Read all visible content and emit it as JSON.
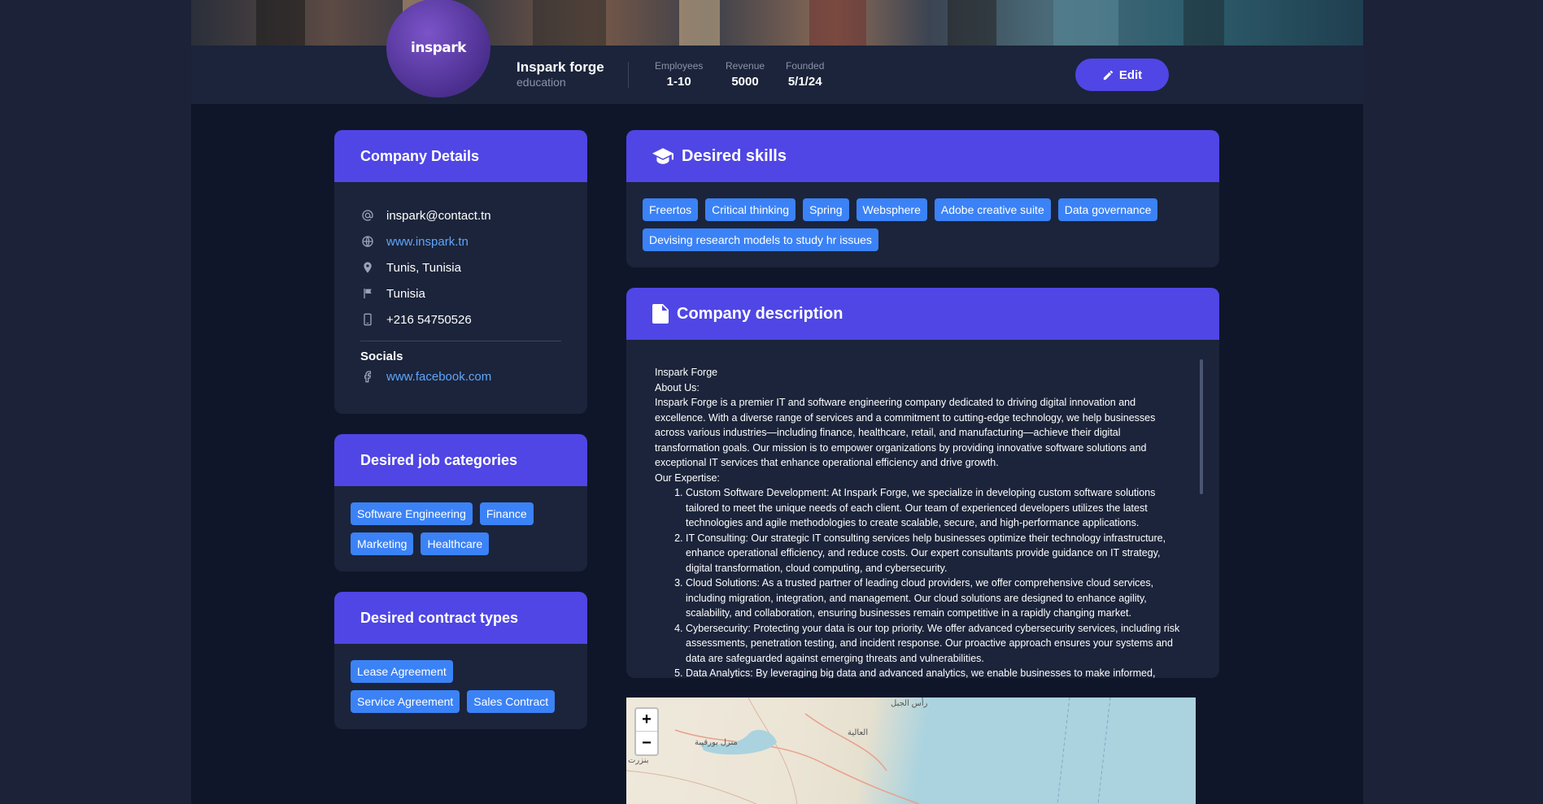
{
  "header": {
    "logo_text": "inspark",
    "company_name": "Inspark forge",
    "sector": "education",
    "stats": [
      {
        "label": "Employees",
        "value": "1-10"
      },
      {
        "label": "Revenue",
        "value": "5000"
      },
      {
        "label": "Founded",
        "value": "5/1/24"
      }
    ],
    "edit_label": "Edit"
  },
  "company_details": {
    "title": "Company Details",
    "email": "inspark@contact.tn",
    "website": "www.inspark.tn",
    "location": "Tunis, Tunisia",
    "country": "Tunisia",
    "phone": "+216 54750526",
    "socials_label": "Socials",
    "facebook": "www.facebook.com"
  },
  "job_categories": {
    "title": "Desired job categories",
    "items": [
      "Software Engineering",
      "Finance",
      "Marketing",
      "Healthcare"
    ]
  },
  "contract_types": {
    "title": "Desired contract types",
    "items": [
      "Lease Agreement",
      "Service Agreement",
      "Sales Contract"
    ]
  },
  "skills": {
    "title": "Desired skills",
    "items": [
      "Freertos",
      "Critical thinking",
      "Spring",
      "Websphere",
      "Adobe creative suite",
      "Data governance",
      "Devising research models to study hr issues"
    ]
  },
  "description": {
    "title": "Company description",
    "heading": "Inspark Forge",
    "about_label": "About Us:",
    "about_text": "Inspark Forge is a premier IT and software engineering company dedicated to driving digital innovation and excellence. With a diverse range of services and a commitment to cutting-edge technology, we help businesses across various industries—including finance, healthcare, retail, and manufacturing—achieve their digital transformation goals. Our mission is to empower organizations by providing innovative software solutions and exceptional IT services that enhance operational efficiency and drive growth.",
    "expertise_label": "Our Expertise:",
    "expertise": [
      "Custom Software Development: At Inspark Forge, we specialize in developing custom software solutions tailored to meet the unique needs of each client. Our team of experienced developers utilizes the latest technologies and agile methodologies to create scalable, secure, and high-performance applications.",
      "IT Consulting: Our strategic IT consulting services help businesses optimize their technology infrastructure, enhance operational efficiency, and reduce costs. Our expert consultants provide guidance on IT strategy, digital transformation, cloud computing, and cybersecurity.",
      "Cloud Solutions: As a trusted partner of leading cloud providers, we offer comprehensive cloud services, including migration, integration, and management. Our cloud solutions are designed to enhance agility, scalability, and collaboration, ensuring businesses remain competitive in a rapidly changing market.",
      "Cybersecurity: Protecting your data is our top priority. We offer advanced cybersecurity services, including risk assessments, penetration testing, and incident response. Our proactive approach ensures your systems and data are safeguarded against emerging threats and vulnerabilities.",
      "Data Analytics: By leveraging big data and advanced analytics, we enable businesses to make informed,"
    ]
  },
  "map": {
    "zoom_in": "+",
    "zoom_out": "−",
    "labels": [
      "رأس الجبل",
      "منزل بورقيبة",
      "العالية",
      "بنزرت"
    ]
  },
  "colors": {
    "accent": "#4f46e5",
    "tag": "#3b82f6",
    "card_bg": "#1b243a",
    "page_bg": "#0f1629",
    "link": "#60a5fa"
  },
  "icons": [
    "pencil-icon",
    "graduation-cap-icon",
    "document-icon",
    "at-icon",
    "globe-icon",
    "location-pin-icon",
    "flag-icon",
    "phone-icon",
    "facebook-icon"
  ]
}
